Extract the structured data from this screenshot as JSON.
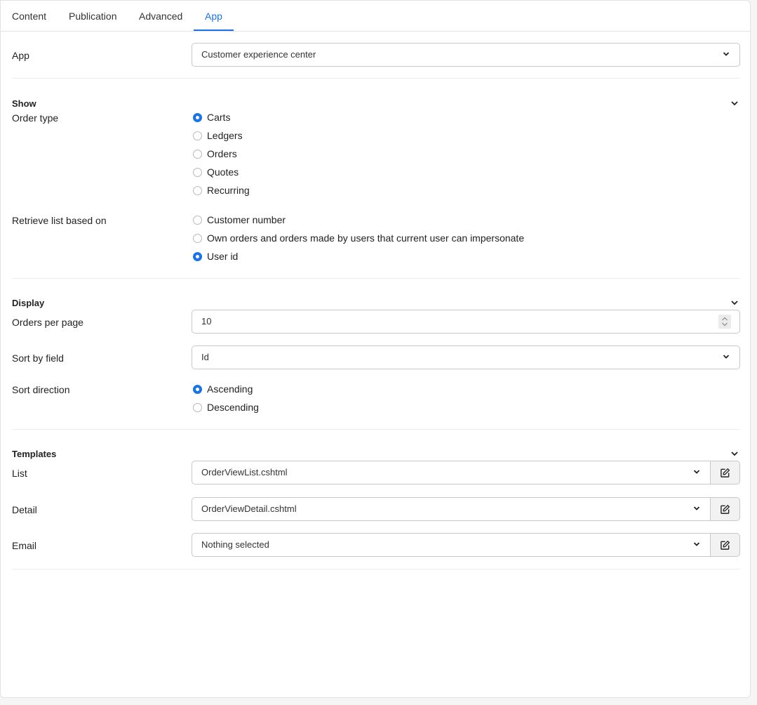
{
  "tabs": [
    {
      "label": "Content",
      "active": false
    },
    {
      "label": "Publication",
      "active": false
    },
    {
      "label": "Advanced",
      "active": false
    },
    {
      "label": "App",
      "active": true
    }
  ],
  "app": {
    "label": "App",
    "value": "Customer experience center"
  },
  "show": {
    "title": "Show",
    "order_type": {
      "label": "Order type",
      "options": [
        "Carts",
        "Ledgers",
        "Orders",
        "Quotes",
        "Recurring"
      ],
      "selected": "Carts"
    },
    "retrieve": {
      "label": "Retrieve list based on",
      "options": [
        "Customer number",
        "Own orders and orders made by users that current user can impersonate",
        "User id"
      ],
      "selected": "User id"
    }
  },
  "display": {
    "title": "Display",
    "orders_per_page": {
      "label": "Orders per page",
      "value": "10"
    },
    "sort_by": {
      "label": "Sort by field",
      "value": "Id"
    },
    "sort_direction": {
      "label": "Sort direction",
      "options": [
        "Ascending",
        "Descending"
      ],
      "selected": "Ascending"
    }
  },
  "templates": {
    "title": "Templates",
    "list": {
      "label": "List",
      "value": "OrderViewList.cshtml"
    },
    "detail": {
      "label": "Detail",
      "value": "OrderViewDetail.cshtml"
    },
    "email": {
      "label": "Email",
      "value": "Nothing selected"
    }
  },
  "colors": {
    "accent": "#1a73e8",
    "background": "#f5f5f5"
  }
}
